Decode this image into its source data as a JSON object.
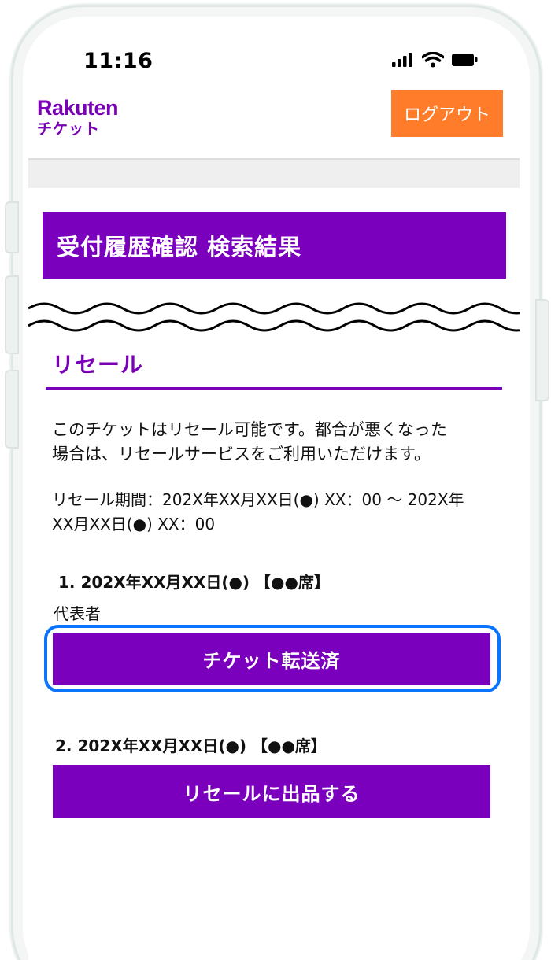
{
  "status_bar": {
    "time": "11:16",
    "icons": [
      "cellular-signal-icon",
      "wifi-icon",
      "battery-icon"
    ]
  },
  "header": {
    "logo_main": "Rakuten",
    "logo_sub": "チケット",
    "logout_label": "ログアウト"
  },
  "page": {
    "title": "受付履歴確認 検索結果"
  },
  "resale": {
    "heading": "リセール",
    "description_line1": "このチケットはリセール可能です。都合が悪くなった",
    "description_line2": "場合は、リセールサービスをご利用いただけます。",
    "period_line1": "リセール期間：202X年XX月XX日(●) XX：00 〜 202X年",
    "period_line2": "XX月XX日(●) XX：00"
  },
  "items": [
    {
      "title": "1. 202X年XX月XX日(●) 【●●席】",
      "role_label": "代表者",
      "button_label": "チケット転送済"
    },
    {
      "title": "2. 202X年XX月XX日(●) 【●●席】",
      "button_label": "リセールに出品する"
    }
  ],
  "colors": {
    "brand_purple": "#7b00bd",
    "logout_orange": "#ff7c2b",
    "focus_blue": "#0b74ff"
  }
}
